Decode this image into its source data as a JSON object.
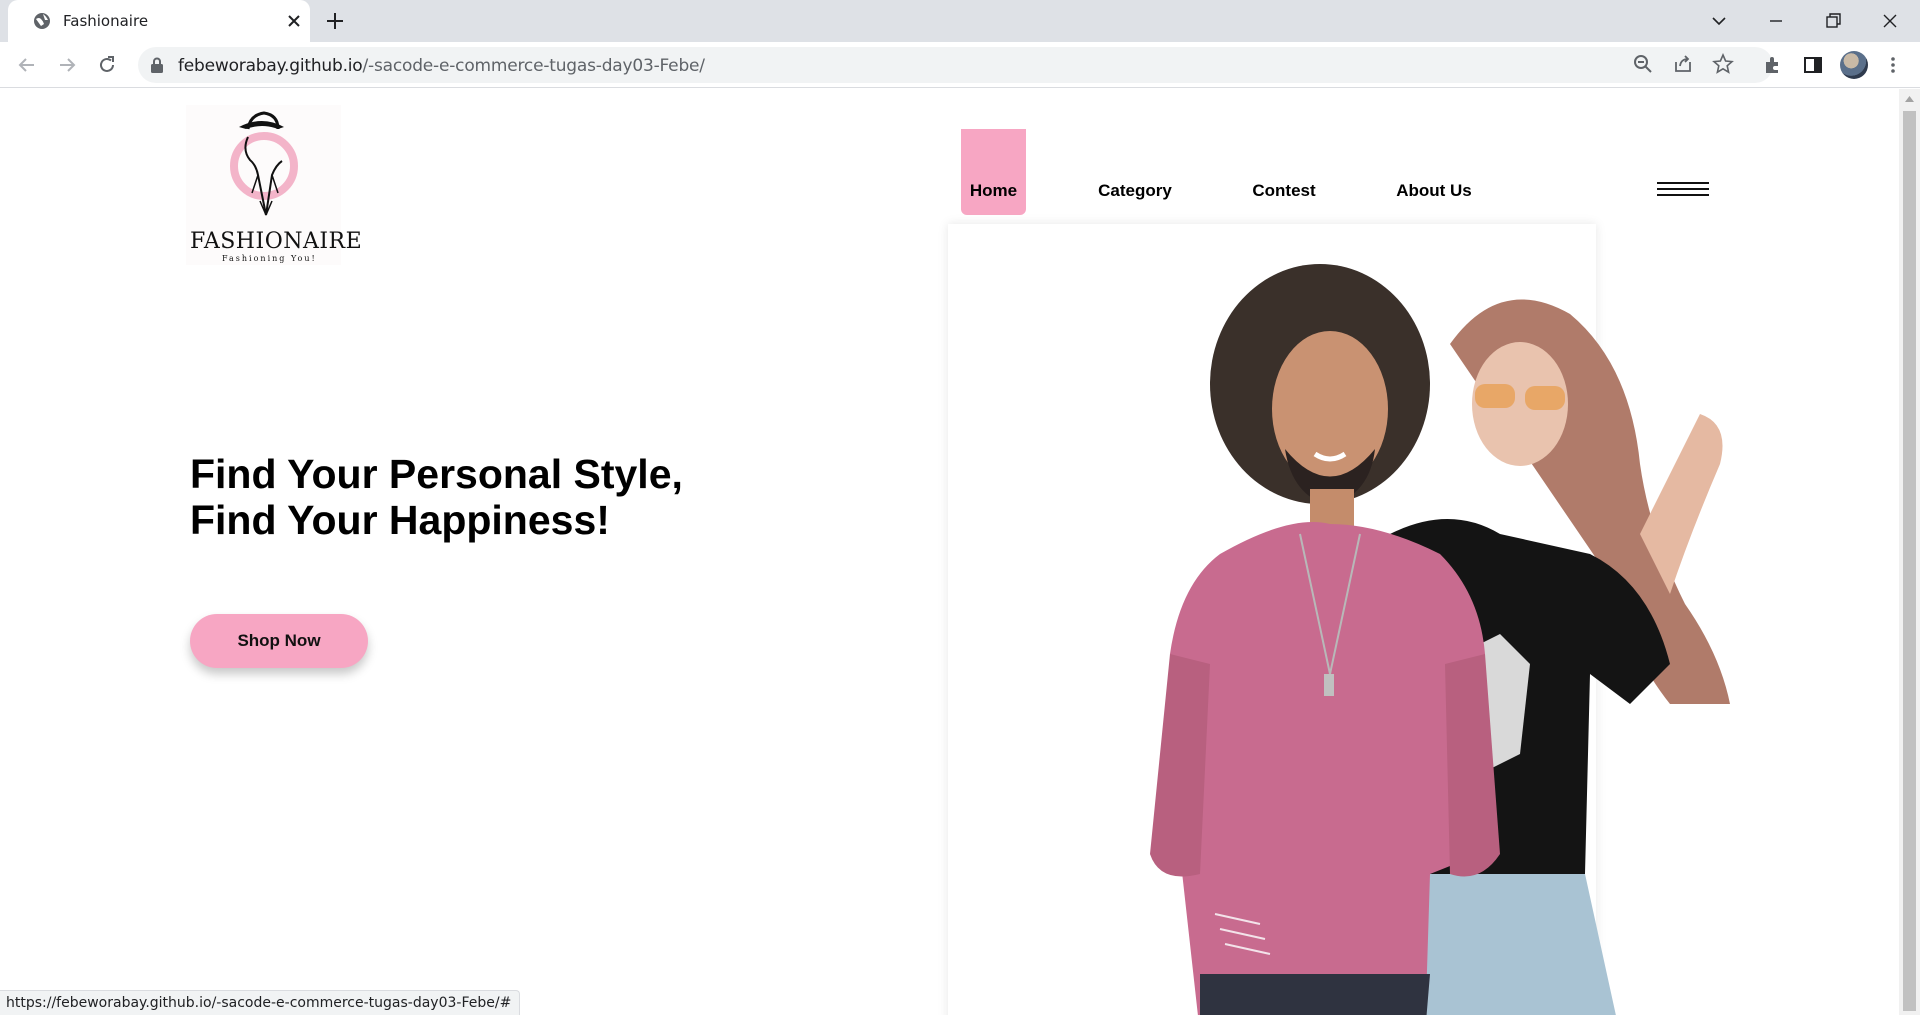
{
  "browser": {
    "tab_title": "Fashionaire",
    "url_host": "febeworabay.github.io",
    "url_path": "/-sacode-e-commerce-tugas-day03-Febe/",
    "status_url": "https://febeworabay.github.io/-sacode-e-commerce-tugas-day03-Febe/#"
  },
  "brand": {
    "name": "Fashionaire",
    "logo_text": "FASHIONAIRE",
    "tagline": "Fashioning You!",
    "accent_color": "#f7a6c3"
  },
  "nav": {
    "items": [
      {
        "label": "Home",
        "active": true
      },
      {
        "label": "Category",
        "active": false
      },
      {
        "label": "Contest",
        "active": false
      },
      {
        "label": "About Us",
        "active": false
      }
    ],
    "menu_icon": "hamburger-icon"
  },
  "hero": {
    "title_line1": "Find Your Personal Style,",
    "title_line2": "Find Your Happiness!",
    "cta_label": "Shop Now"
  }
}
